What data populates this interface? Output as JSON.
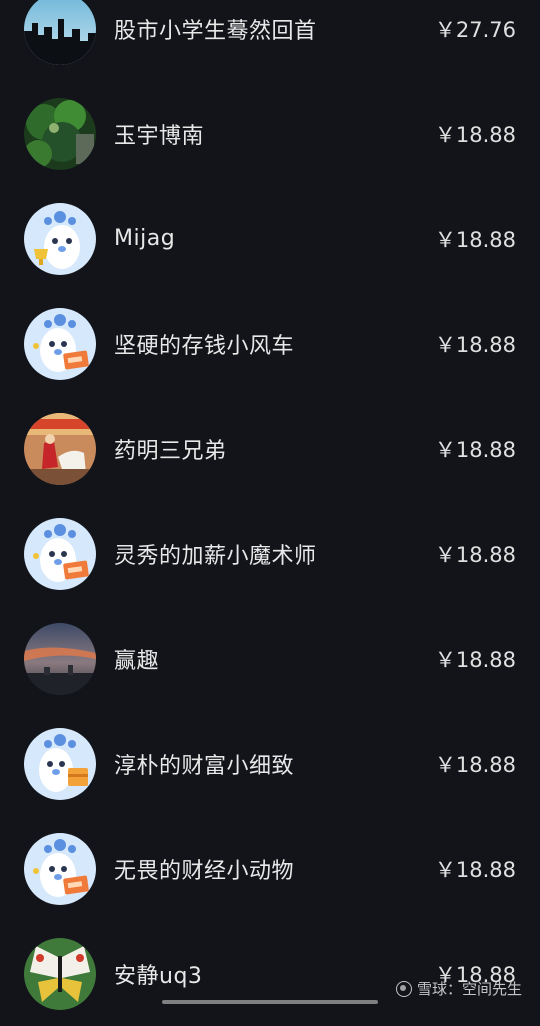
{
  "supporters": [
    {
      "name": "股市小学生蓦然回首",
      "amount": "￥27.76",
      "avatar": "city-skyline-avatar"
    },
    {
      "name": "玉宇博南",
      "amount": "￥18.88",
      "avatar": "forest-avatar"
    },
    {
      "name": "Mijag",
      "amount": "￥18.88",
      "avatar": "mascot-trophy-avatar"
    },
    {
      "name": "坚硬的存钱小风车",
      "amount": "￥18.88",
      "avatar": "mascot-sign-avatar"
    },
    {
      "name": "药明三兄弟",
      "amount": "￥18.88",
      "avatar": "horseman-avatar"
    },
    {
      "name": "灵秀的加薪小魔术师",
      "amount": "￥18.88",
      "avatar": "mascot-sign-avatar"
    },
    {
      "name": "赢趣",
      "amount": "￥18.88",
      "avatar": "sunset-sky-avatar"
    },
    {
      "name": "淳朴的财富小细致",
      "amount": "￥18.88",
      "avatar": "mascot-box-avatar"
    },
    {
      "name": "无畏的财经小动物",
      "amount": "￥18.88",
      "avatar": "mascot-sign-avatar"
    },
    {
      "name": "安静uq3",
      "amount": "￥18.88",
      "avatar": "butterfly-avatar"
    }
  ],
  "watermark": "雪球：空间先生",
  "colors": {
    "background": "#12141a",
    "mascot_bg": "#d6e8fb",
    "sign_orange": "#f07a3a"
  }
}
